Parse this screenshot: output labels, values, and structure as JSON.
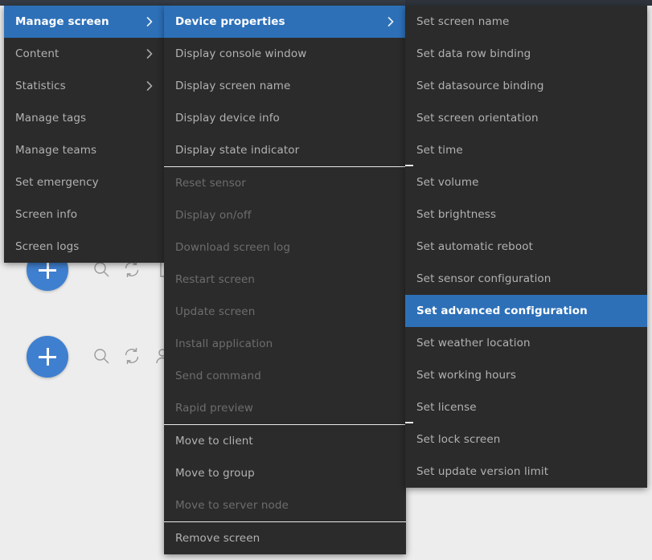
{
  "colors": {
    "menu_background": "#2b2b2b",
    "highlight": "#2d70b8",
    "text": "#b2b2b2",
    "text_disabled": "#6d6d6d",
    "separator": "#e9e9e9",
    "app_background": "#ededed",
    "fab": "#3f7fcf"
  },
  "background": {
    "fab_label": "add-button",
    "icons": [
      "search-icon",
      "refresh-icon",
      "user-icon",
      "bracket-icon"
    ]
  },
  "menus": {
    "column_1": {
      "name": "screen-context-menu",
      "items": [
        {
          "label": "Manage screen",
          "state": "selected",
          "submenu": true
        },
        {
          "label": "Content",
          "state": "normal",
          "submenu": true
        },
        {
          "label": "Statistics",
          "state": "normal",
          "submenu": true
        },
        {
          "label": "Manage tags",
          "state": "normal",
          "submenu": false
        },
        {
          "label": "Manage teams",
          "state": "normal",
          "submenu": false
        },
        {
          "label": "Set emergency",
          "state": "normal",
          "submenu": false
        },
        {
          "label": "Screen info",
          "state": "normal",
          "submenu": false
        },
        {
          "label": "Screen logs",
          "state": "normal",
          "submenu": false
        }
      ]
    },
    "column_2": {
      "name": "manage-screen-submenu",
      "items": [
        {
          "label": "Device properties",
          "state": "selected",
          "submenu": true
        },
        {
          "label": "Display console window",
          "state": "normal",
          "submenu": false
        },
        {
          "label": "Display screen name",
          "state": "normal",
          "submenu": false
        },
        {
          "label": "Display device info",
          "state": "normal",
          "submenu": false
        },
        {
          "label": "Display state indicator",
          "state": "normal",
          "submenu": false
        },
        {
          "separator": true
        },
        {
          "label": "Reset sensor",
          "state": "disabled",
          "submenu": false
        },
        {
          "label": "Display on/off",
          "state": "disabled",
          "submenu": false
        },
        {
          "label": "Download screen log",
          "state": "disabled",
          "submenu": false
        },
        {
          "label": "Restart screen",
          "state": "disabled",
          "submenu": false
        },
        {
          "label": "Update screen",
          "state": "disabled",
          "submenu": false
        },
        {
          "label": "Install application",
          "state": "disabled",
          "submenu": false
        },
        {
          "label": "Send command",
          "state": "disabled",
          "submenu": false
        },
        {
          "label": "Rapid preview",
          "state": "disabled",
          "submenu": false
        },
        {
          "separator": true
        },
        {
          "label": "Move to client",
          "state": "normal",
          "submenu": false
        },
        {
          "label": "Move to group",
          "state": "normal",
          "submenu": false
        },
        {
          "label": "Move to server node",
          "state": "disabled",
          "submenu": false
        },
        {
          "separator": true
        },
        {
          "label": "Remove screen",
          "state": "normal",
          "submenu": false
        }
      ]
    },
    "column_3": {
      "name": "device-properties-submenu",
      "items": [
        {
          "label": "Set screen name",
          "state": "normal",
          "submenu": false
        },
        {
          "label": "Set data row binding",
          "state": "normal",
          "submenu": false
        },
        {
          "label": "Set datasource binding",
          "state": "normal",
          "submenu": false
        },
        {
          "label": "Set screen orientation",
          "state": "normal",
          "submenu": false
        },
        {
          "label": "Set time",
          "state": "normal",
          "submenu": false
        },
        {
          "label": "Set volume",
          "state": "normal",
          "submenu": false
        },
        {
          "label": "Set brightness",
          "state": "normal",
          "submenu": false
        },
        {
          "label": "Set automatic reboot",
          "state": "normal",
          "submenu": false
        },
        {
          "label": "Set sensor configuration",
          "state": "normal",
          "submenu": false
        },
        {
          "label": "Set advanced configuration",
          "state": "selected",
          "submenu": false
        },
        {
          "label": "Set weather location",
          "state": "normal",
          "submenu": false
        },
        {
          "label": "Set working hours",
          "state": "normal",
          "submenu": false
        },
        {
          "label": "Set license",
          "state": "normal",
          "submenu": false
        },
        {
          "label": "Set lock screen",
          "state": "normal",
          "submenu": false
        },
        {
          "label": "Set update version limit",
          "state": "normal",
          "submenu": false
        }
      ]
    }
  }
}
